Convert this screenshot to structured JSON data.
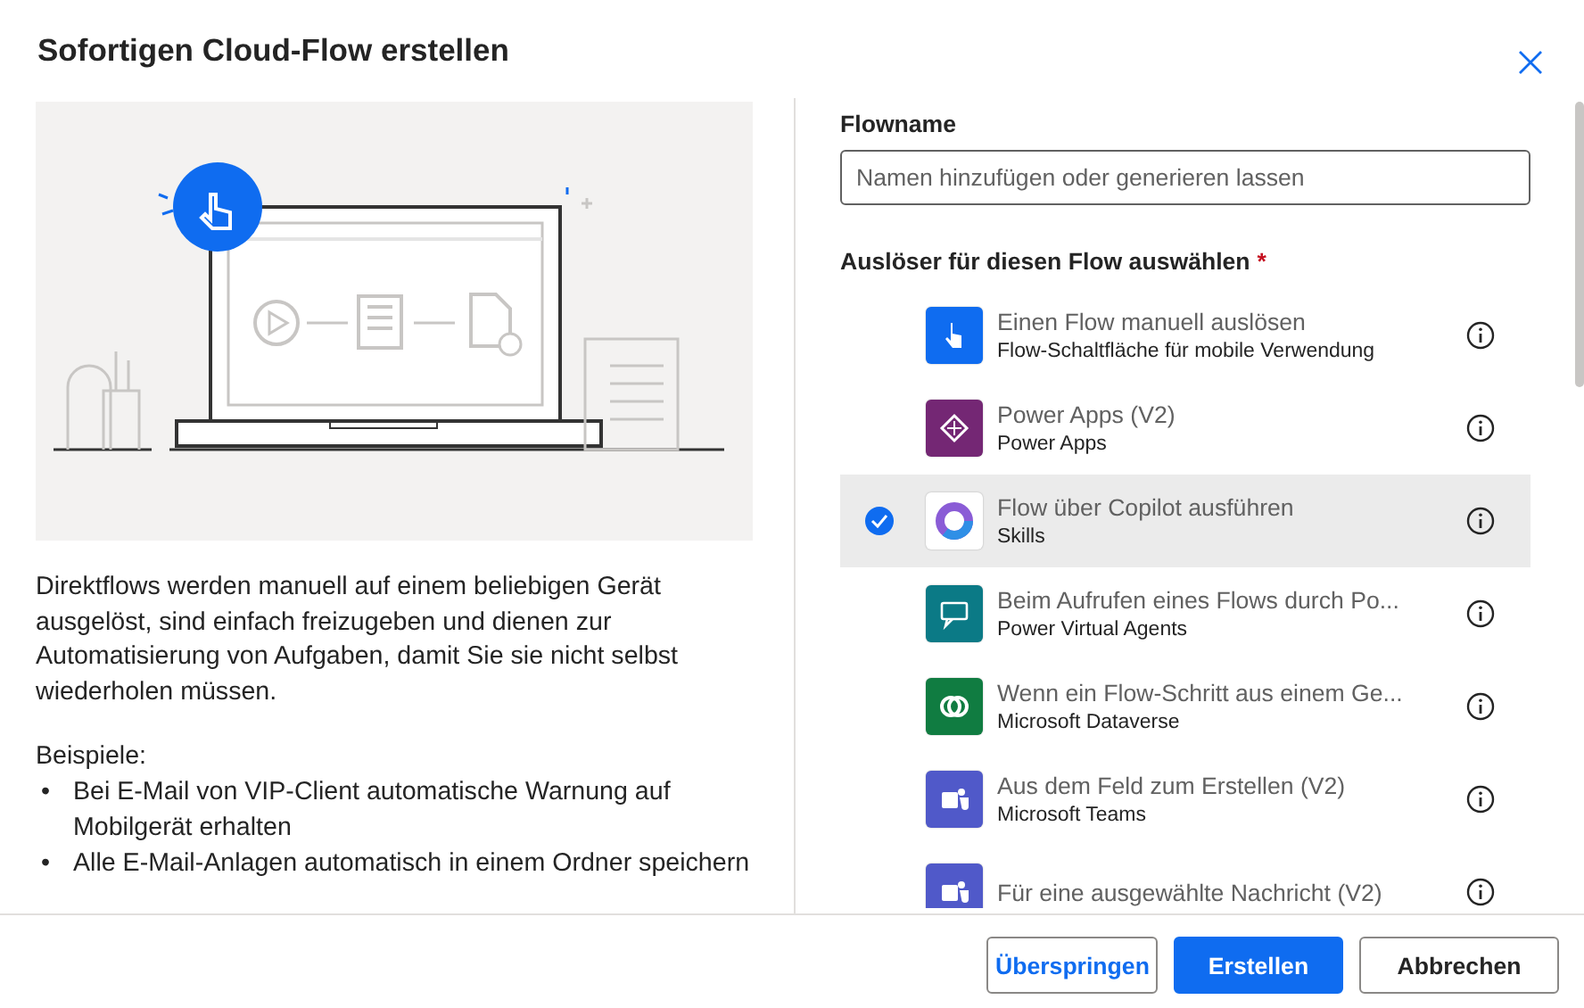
{
  "dialog": {
    "title": "Sofortigen Cloud-Flow erstellen"
  },
  "info": {
    "description": "Direktflows werden manuell auf einem beliebigen Gerät ausgelöst, sind einfach freizugeben und dienen zur Automatisierung von Aufgaben, damit Sie sie nicht selbst wiederholen müssen.",
    "examples_label": "Beispiele:",
    "bullet": "•",
    "examples": [
      "Bei E-Mail von VIP-Client automatische Warnung auf Mobilgerät erhalten",
      "Alle E-Mail-Anlagen automatisch in einem Ordner speichern"
    ]
  },
  "flow_name": {
    "label": "Flowname",
    "placeholder": "Namen hinzufügen oder generieren lassen"
  },
  "triggers": {
    "label": "Auslöser für diesen Flow auswählen",
    "required_mark": "*",
    "items": [
      {
        "kind": "button",
        "color": "#0f6cf0",
        "title": "Einen Flow manuell auslösen",
        "subtitle": "Flow-Schaltfläche für mobile Verwendung",
        "selected": false
      },
      {
        "kind": "powerapps",
        "color": "#742774",
        "title": "Power Apps (V2)",
        "subtitle": "Power Apps",
        "selected": false
      },
      {
        "kind": "copilot",
        "color": "#ffffff",
        "title": "Flow über Copilot ausführen",
        "subtitle": "Skills",
        "selected": true
      },
      {
        "kind": "chat",
        "color": "#0b7a86",
        "title": "Beim Aufrufen eines Flows durch Po...",
        "subtitle": "Power Virtual Agents",
        "selected": false
      },
      {
        "kind": "dataverse",
        "color": "#107c41",
        "title": "Wenn ein Flow-Schritt aus einem Ge...",
        "subtitle": "Microsoft Dataverse",
        "selected": false
      },
      {
        "kind": "teams",
        "color": "#5059c9",
        "title": "Aus dem Feld zum Erstellen (V2)",
        "subtitle": "Microsoft Teams",
        "selected": false
      },
      {
        "kind": "teams",
        "color": "#5059c9",
        "title": "Für eine ausgewählte Nachricht (V2)",
        "selected": false
      }
    ]
  },
  "buttons": [
    {
      "kind": "secondary-link",
      "label": "Überspringen"
    },
    {
      "kind": "primary",
      "label": "Erstellen"
    },
    {
      "kind": "secondary",
      "label": "Abbrechen"
    }
  ]
}
